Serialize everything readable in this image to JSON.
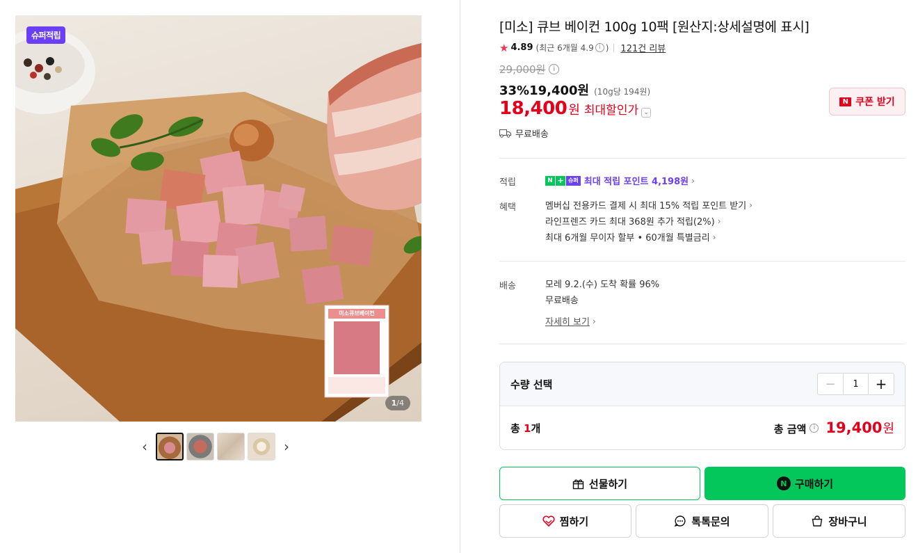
{
  "gallery": {
    "badge": "슈퍼적립",
    "product_label_title": "미소큐브베이컨",
    "counter_current": "1",
    "counter_sep": "/",
    "counter_total": "4",
    "thumbnails": [
      "thumb-1",
      "thumb-2",
      "thumb-3",
      "thumb-4"
    ]
  },
  "product": {
    "title": "[미소] 큐브 베이컨 100g 10팩 [원산지:상세설명에 표시]",
    "rating": "4.89",
    "recent_rating": "(최근 6개월 4.9",
    "recent_rating_close": ")",
    "review_link": "121건 리뷰",
    "original_price": "29,000원",
    "discount_rate": "33%",
    "sale_price": "19,400원",
    "unit_price": "(10g당 194원)",
    "max_price": "18,400",
    "max_price_unit": "원",
    "max_price_label": "최대할인가",
    "coupon_button": "쿠폰 받기",
    "shipping_badge": "무료배송"
  },
  "benefits": {
    "points_label": "적립",
    "points_badge_n": "N",
    "points_badge_plus": "+",
    "points_badge_super": "슈퍼",
    "points_text": "최대 적립 포인트 4,198원",
    "benefit_label": "혜택",
    "benefit_items": [
      "멤버십 전용카드 결제 시 최대 15% 적립 포인트 받기",
      "라인프렌즈 카드 최대 368원 추가 적립(2%)",
      "최대 6개월 무이자 할부 • 60개월 특별금리"
    ]
  },
  "delivery": {
    "label": "배송",
    "arrival": "모레 9.2.(수) 도착 확률 96%",
    "fee": "무료배송",
    "detail_link": "자세히 보기"
  },
  "quantity": {
    "label": "수량 선택",
    "minus": "−",
    "value": "1",
    "plus": "+",
    "count_prefix": "총 ",
    "count_value": "1",
    "count_suffix": "개",
    "total_label": "총 금액",
    "total_amount": "19,400",
    "total_unit": "원"
  },
  "actions": {
    "gift": "선물하기",
    "buy": "구매하기",
    "wish": "찜하기",
    "talk": "톡톡문의",
    "cart": "장바구니"
  },
  "colors": {
    "accent_red": "#e4001b",
    "naver_green": "#03c75a",
    "super_purple": "#6b3ff5"
  }
}
